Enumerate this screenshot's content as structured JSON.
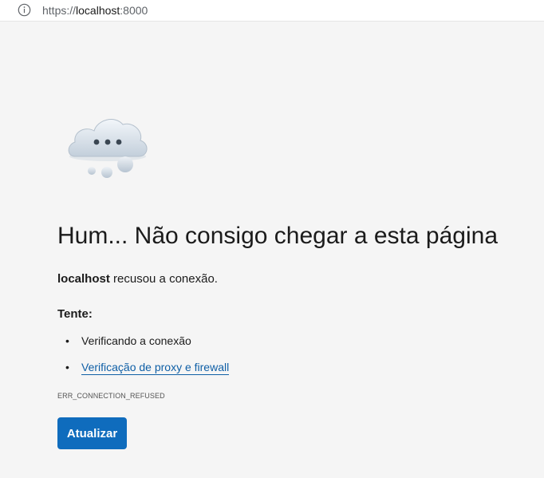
{
  "address_bar": {
    "scheme": "https://",
    "host": "localhost",
    "port": ":8000"
  },
  "icons": {
    "info": "info-circle-icon",
    "illustration": "thinking-cloud-icon"
  },
  "error_page": {
    "headline": "Hum... Não consigo chegar a esta página",
    "message_host": "localhost",
    "message_rest": " recusou a conexão.",
    "try_label": "Tente:",
    "suggestions": [
      {
        "bullet": "•",
        "text": "Verificando a conexão"
      },
      {
        "bullet": "•",
        "text": "Verificação de proxy e firewall"
      }
    ],
    "error_code": "ERR_CONNECTION_REFUSED",
    "refresh_button": "Atualizar"
  },
  "colors": {
    "page_background": "#f5f5f5",
    "button_accent": "#0f6cbd",
    "link": "#0f5fa6"
  }
}
